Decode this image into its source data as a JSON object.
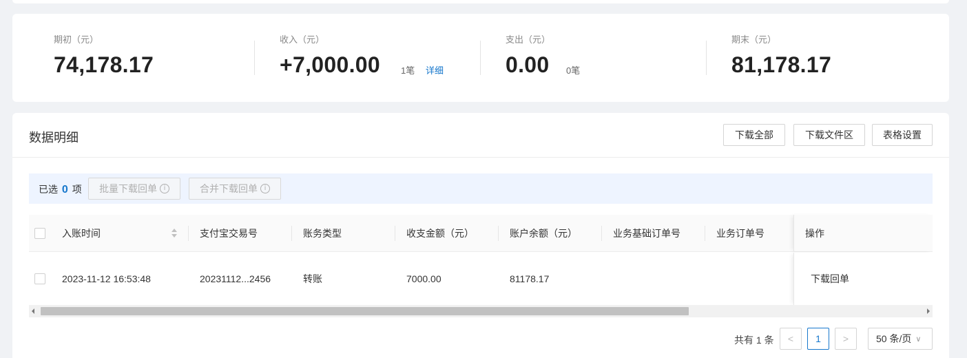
{
  "summary": {
    "opening": {
      "label": "期初（元）",
      "value": "74,178.17"
    },
    "income": {
      "label": "收入（元）",
      "value": "+7,000.00",
      "count": "1笔",
      "detail_link": "详细"
    },
    "expense": {
      "label": "支出（元）",
      "value": "0.00",
      "count": "0笔"
    },
    "closing": {
      "label": "期末（元）",
      "value": "81,178.17"
    }
  },
  "panel": {
    "title": "数据明细",
    "buttons": {
      "download_all": "下载全部",
      "download_files": "下载文件区",
      "table_settings": "表格设置"
    }
  },
  "selection": {
    "prefix": "已选",
    "count": "0",
    "suffix": "项",
    "batch_download": "批量下载回单",
    "merge_download": "合并下载回单"
  },
  "table": {
    "columns": [
      "入账时间",
      "支付宝交易号",
      "账务类型",
      "收支金额（元）",
      "账户余额（元）",
      "业务基础订单号",
      "业务订单号",
      "操作"
    ],
    "rows": [
      {
        "time": "2023-11-12 16:53:48",
        "trade_no": "20231112...2456",
        "type": "转账",
        "amount": "7000.00",
        "balance": "81178.17",
        "base_order": "",
        "order": "",
        "action": "下载回单"
      }
    ]
  },
  "pagination": {
    "total_text": "共有 1 条",
    "current_page": "1",
    "prev": "<",
    "next": ">",
    "page_size": "50 条/页"
  }
}
